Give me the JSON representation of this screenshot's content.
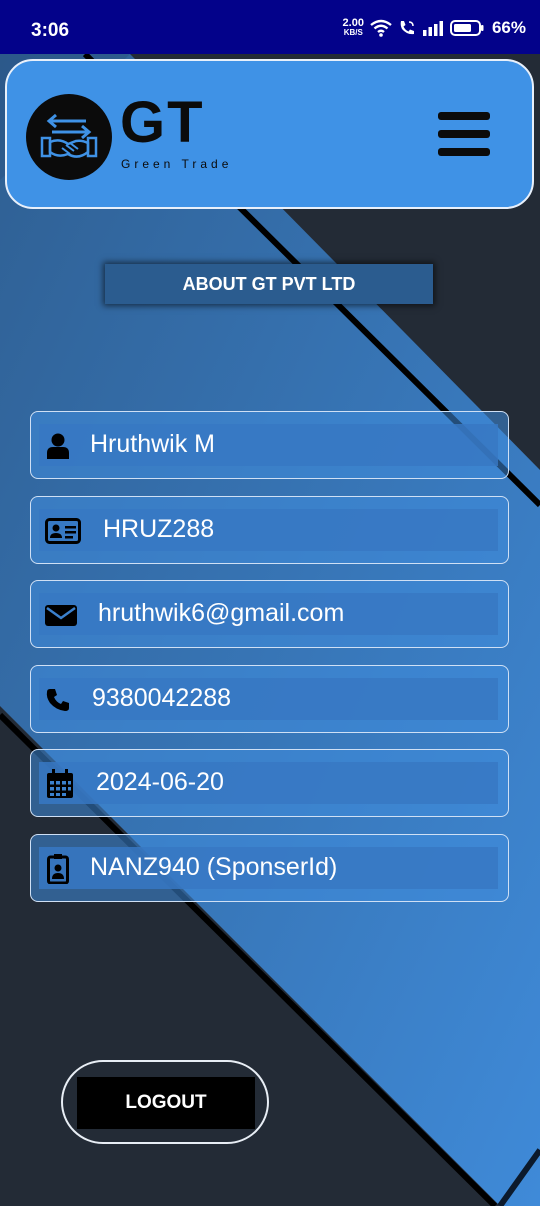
{
  "status_bar": {
    "time": "3:06",
    "network_speed_value": "2.00",
    "network_speed_unit": "KB/S",
    "battery": "66%"
  },
  "header": {
    "logo_text": "GT",
    "logo_subtitle": "Green Trade"
  },
  "about_button_label": "ABOUT GT PVT LTD",
  "profile_fields": [
    {
      "icon": "user-icon",
      "value": "Hruthwik M"
    },
    {
      "icon": "id-card-icon",
      "value": "HRUZ288"
    },
    {
      "icon": "envelope-icon",
      "value": "hruthwik6@gmail.com"
    },
    {
      "icon": "phone-icon",
      "value": "9380042288"
    },
    {
      "icon": "calendar-icon",
      "value": "2024-06-20"
    },
    {
      "icon": "badge-icon",
      "value": "NANZ940  (SponserId)"
    }
  ],
  "logout_label": "LOGOUT",
  "colors": {
    "status_bar": "#03028a",
    "header_bg": "#3f92e6",
    "background_dark": "#232b36",
    "background_blue": "#3b86d6",
    "logout_bg": "#000000"
  }
}
